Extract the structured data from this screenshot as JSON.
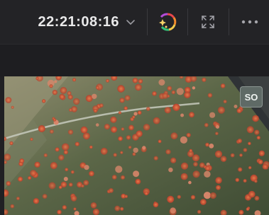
{
  "viewer_toolbar": {
    "timecode": "22:21:08:16",
    "icons": {
      "timecode_menu": "chevron-down-icon",
      "color": "color-wheel-sparkle-icon",
      "fullscreen": "expand-arrows-icon",
      "more": "more-options-icon"
    }
  },
  "viewer": {
    "overlay_badge": "SO",
    "content": "flower-field-footage"
  },
  "colors": {
    "toolbar_bg": "#232326",
    "timecode_text": "#e9e9ea",
    "badge_bg": "#5f6a66"
  }
}
